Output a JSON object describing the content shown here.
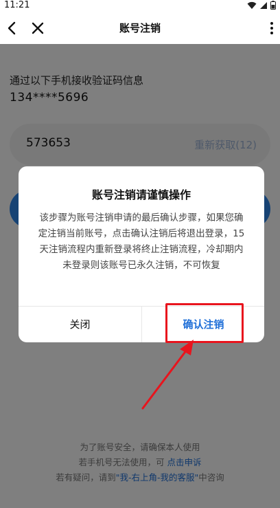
{
  "status_bar": {
    "time": "11:21"
  },
  "navbar": {
    "title": "账号注销"
  },
  "page": {
    "info_text": "通过以下手机接收验证码信息",
    "phone": "134****5696",
    "code_value": "573653",
    "resend_label": "重新获取(12)"
  },
  "footer": {
    "line1": "为了账号安全，请确保本人使用",
    "line2_prefix": "若手机号无法使用，可",
    "line2_link": "点击申诉",
    "line3_prefix": "若有疑问，请到",
    "line3_link": "\"我-右上角-我的客服\"",
    "line3_suffix": "中咨询"
  },
  "dialog": {
    "title": "账号注销请谨慎操作",
    "message": "该步骤为账号注销申请的最后确认步骤，如果您确定注销当前账号，点击确认注销后将退出登录，15天注销流程内重新登录将终止注销流程，冷却期内未登录则该账号已永久注销，不可恢复",
    "close_label": "关闭",
    "confirm_label": "确认注销"
  },
  "colors": {
    "primary": "#2f86e8",
    "link": "#1f6fd8",
    "annotation": "#e8141d"
  }
}
